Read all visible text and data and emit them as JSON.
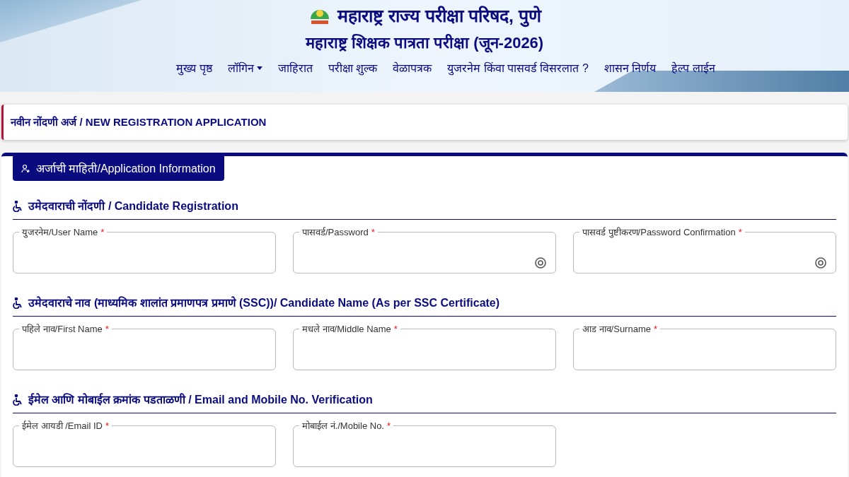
{
  "header": {
    "org_title": "महाराष्ट्र राज्य परीक्षा परिषद, पुणे",
    "exam_title": "महाराष्ट्र शिक्षक पात्रता परीक्षा (जून-2026)"
  },
  "nav": [
    {
      "label": "मुख्य पृष्ठ",
      "dropdown": false
    },
    {
      "label": "लॉगिन",
      "dropdown": true
    },
    {
      "label": "जाहिरात",
      "dropdown": false
    },
    {
      "label": "परीक्षा शुल्क",
      "dropdown": false
    },
    {
      "label": "वेळापत्रक",
      "dropdown": false
    },
    {
      "label": "युजरनेम किंवा पासवर्ड विसरलात ?",
      "dropdown": false
    },
    {
      "label": "शासन निर्णय",
      "dropdown": false
    },
    {
      "label": "हेल्प लाईन",
      "dropdown": false
    }
  ],
  "page_title": "नवीन नोंदणी अर्ज / NEW REGISTRATION APPLICATION",
  "form_tab": "अर्जाची माहिती/Application Information",
  "sections": [
    {
      "title": "उमेदवाराची नोंदणी / Candidate Registration",
      "fields": [
        {
          "label": "युजरनेम/User Name",
          "required_mark": "*",
          "kind": "text"
        },
        {
          "label": "पासवर्ड/Password",
          "required_mark": "*",
          "kind": "password"
        },
        {
          "label": "पासवर्ड पुष्टीकरण/Password Confirmation",
          "required_mark": "*",
          "kind": "password"
        }
      ]
    },
    {
      "title": "उमेदवाराचे नाव (माध्यमिक शालांत प्रमाणपत्र प्रमाणे (SSC))/ Candidate Name (As per SSC Certificate)",
      "fields": [
        {
          "label": "पहिले नाव/First Name",
          "required_mark": "*",
          "kind": "text"
        },
        {
          "label": "मधले नाव/Middle Name",
          "required_mark": "*",
          "kind": "text"
        },
        {
          "label": "आड नाव/Surname",
          "required_mark": "*",
          "kind": "text"
        }
      ]
    },
    {
      "title": "ईमेल आणि मोबाईल क्रमांक पडताळणी / Email and Mobile No. Verification",
      "fields": [
        {
          "label": "ईमेल आयडी /Email ID",
          "required_mark": "*",
          "kind": "text"
        },
        {
          "label": "मोबाईल नं./Mobile No.",
          "required_mark": "*",
          "kind": "text"
        }
      ]
    }
  ]
}
